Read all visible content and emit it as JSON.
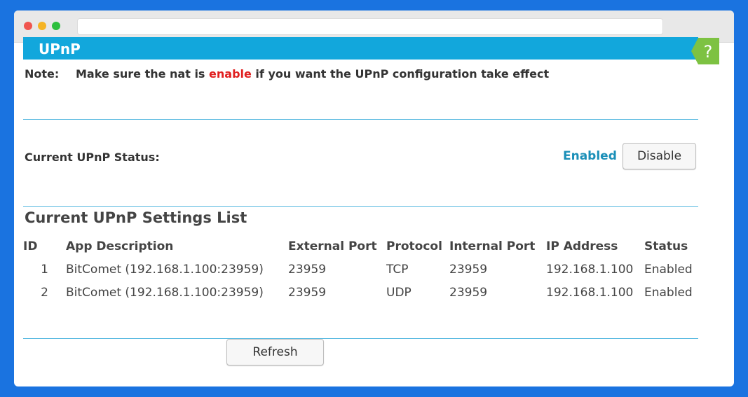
{
  "header": {
    "title": "UPnP"
  },
  "note": {
    "label": "Note:",
    "text_before": "Make sure the nat is ",
    "highlight": "enable",
    "text_after": " if you want the UPnP configuration take effect"
  },
  "status": {
    "label": "Current UPnP Status:",
    "value": "Enabled",
    "toggle_button": "Disable"
  },
  "settings_list": {
    "title": "Current UPnP Settings List",
    "columns": [
      "ID",
      "App Description",
      "External Port",
      "Protocol",
      "Internal Port",
      "IP Address",
      "Status"
    ],
    "rows": [
      {
        "id": "1",
        "app": "BitComet (192.168.1.100:23959)",
        "external_port": "23959",
        "protocol": "TCP",
        "internal_port": "23959",
        "ip": "192.168.1.100",
        "status": "Enabled"
      },
      {
        "id": "2",
        "app": "BitComet (192.168.1.100:23959)",
        "external_port": "23959",
        "protocol": "UDP",
        "internal_port": "23959",
        "ip": "192.168.1.100",
        "status": "Enabled"
      }
    ]
  },
  "refresh_button": "Refresh",
  "help_icon": "help-question-icon",
  "colors": {
    "page_background": "#1a73e0",
    "header_bar": "#12a7dc",
    "status_enabled": "#1a8fb8",
    "highlight_red": "#e02020",
    "help_badge": "#7dc242"
  }
}
